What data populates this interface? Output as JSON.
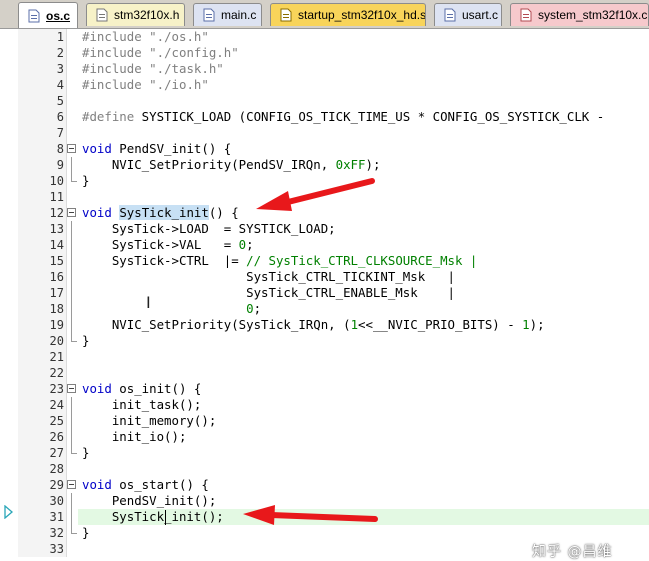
{
  "tabs": [
    {
      "label": "os.c",
      "active": true
    },
    {
      "label": "stm32f10x.h",
      "active": false
    },
    {
      "label": "main.c",
      "active": false
    },
    {
      "label": "startup_stm32f10x_hd.s",
      "active": false
    },
    {
      "label": "usart.c",
      "active": false
    },
    {
      "label": "system_stm32f10x.c",
      "active": false
    }
  ],
  "editor": {
    "line_numbers": [
      "1",
      "2",
      "3",
      "4",
      "5",
      "6",
      "7",
      "8",
      "9",
      "10",
      "11",
      "12",
      "13",
      "14",
      "15",
      "16",
      "17",
      "18",
      "19",
      "20",
      "21",
      "22",
      "23",
      "24",
      "25",
      "26",
      "27",
      "28",
      "29",
      "30",
      "31",
      "32",
      "33"
    ],
    "lines": [
      "#include \"./os.h\"",
      "#include \"./config.h\"",
      "#include \"./task.h\"",
      "#include \"./io.h\"",
      "",
      "#define SYSTICK_LOAD (CONFIG_OS_TICK_TIME_US * CONFIG_OS_SYSTICK_CLK -",
      "",
      "void PendSV_init() {",
      "    NVIC_SetPriority(PendSV_IRQn, 0xFF);",
      "}",
      "",
      "void SysTick_init() {",
      "    SysTick->LOAD  = SYSTICK_LOAD;",
      "    SysTick->VAL   = 0;",
      "    SysTick->CTRL  |= // SysTick_CTRL_CLKSOURCE_Msk |",
      "                      SysTick_CTRL_TICKINT_Msk   |",
      "                      SysTick_CTRL_ENABLE_Msk    |",
      "                      0;",
      "    NVIC_SetPriority(SysTick_IRQn, (1<<__NVIC_PRIO_BITS) - 1);",
      "}",
      "",
      "",
      "void os_init() {",
      "    init_task();",
      "    init_memory();",
      "    init_io();",
      "}",
      "",
      "void os_start() {",
      "    PendSV_init();",
      "    SysTick_init();",
      "}",
      ""
    ]
  },
  "watermark": "知乎 @昌维",
  "colors": {
    "tab_bar": "#d4d0c8",
    "keyword": "#0000c8",
    "number": "#008000",
    "comment": "#008000",
    "preprocessor": "#808080",
    "current_line": "#e3f9e3",
    "selection": "#c7e0f4",
    "arrow": "#e8181b"
  }
}
